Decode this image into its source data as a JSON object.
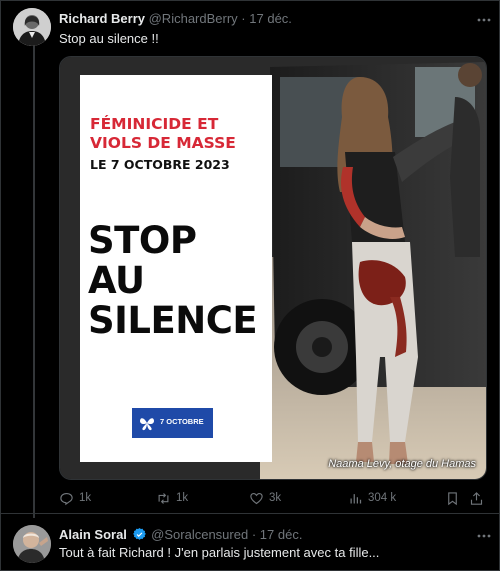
{
  "tweet": {
    "author_name": "Richard Berry",
    "author_handle": "@RichardBerry",
    "separator": "·",
    "date": "17 déc.",
    "text": "Stop au silence !!",
    "media": {
      "poster_line1": "FÉMINICIDE ET",
      "poster_line2": "VIOLS DE MASSE",
      "poster_date": "LE 7 OCTOBRE 2023",
      "poster_big1": "STOP",
      "poster_big2": "AU",
      "poster_big3": "SILENCE",
      "badge_text": "7 OCTOBRE",
      "caption": "Naama Levy, otage du Hamas"
    },
    "stats": {
      "replies": "1k",
      "retweets": "1k",
      "likes": "3k",
      "views": "304 k"
    }
  },
  "reply": {
    "author_name": "Alain Soral",
    "author_handle": "@Soralcensured",
    "separator": "·",
    "date": "17 déc.",
    "text": "Tout à fait Richard ! J'en parlais justement avec ta fille..."
  },
  "icons": {
    "verified_color": "#1d9bf0",
    "brand_blue": "#1f4aa8",
    "poster_red": "#d72836"
  }
}
